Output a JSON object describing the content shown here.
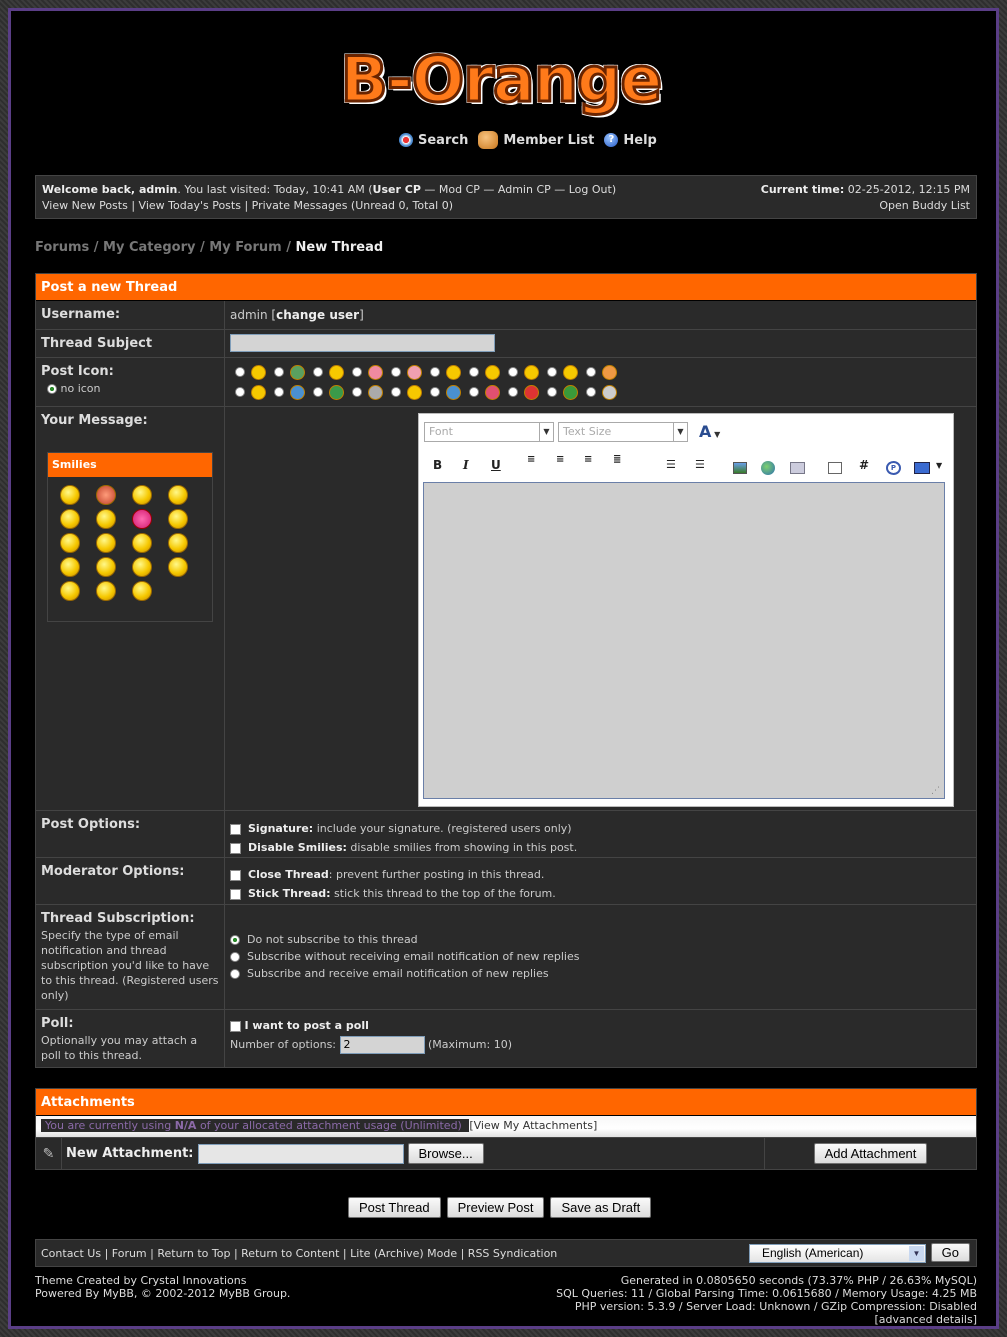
{
  "logo": {
    "text": "B-Orange"
  },
  "nav": {
    "search": "Search",
    "members": "Member List",
    "help": "Help"
  },
  "welcome": {
    "prefix": "Welcome back, ",
    "user": "admin",
    "visited": ". You last visited: Today, 10:41 AM (",
    "usercp": "User CP",
    "rest": " — Mod CP — Admin CP — Log Out)",
    "line2": "View New Posts | View Today's Posts | Private Messages (Unread 0, Total 0)",
    "time_label": "Current time:",
    "time_value": " 02-25-2012, 12:15 PM",
    "buddy": "Open Buddy List"
  },
  "breadcrumb": {
    "forums": "Forums",
    "sep": " / ",
    "category": "My Category",
    "forum": "My Forum",
    "current": "New Thread"
  },
  "form": {
    "title": "Post a new Thread",
    "username_label": "Username:",
    "username_value": "admin [",
    "change_user": "change user",
    "username_close": "]",
    "subject_label": "Thread Subject",
    "icon_label": "Post Icon:",
    "no_icon": "no icon",
    "message_label": "Your Message:",
    "smilies_title": "Smilies",
    "font_placeholder": "Font",
    "size_placeholder": "Text Size",
    "options_label": "Post Options:",
    "opt_sig_b": "Signature:",
    "opt_sig": " include your signature. (registered users only)",
    "opt_smil_b": "Disable Smilies:",
    "opt_smil": " disable smilies from showing in this post.",
    "mod_label": "Moderator Options:",
    "mod_close_b": "Close Thread",
    "mod_close": ": prevent further posting in this thread.",
    "mod_stick_b": "Stick Thread:",
    "mod_stick": " stick this thread to the top of the forum.",
    "sub_label": "Thread Subscription:",
    "sub_desc": "Specify the type of email notification and thread subscription you'd like to have to this thread. (Registered users only)",
    "sub_opt1": "Do not subscribe to this thread",
    "sub_opt2": "Subscribe without receiving email notification of new replies",
    "sub_opt3": "Subscribe and receive email notification of new replies",
    "poll_label": "Poll:",
    "poll_desc": "Optionally you may attach a poll to this thread.",
    "poll_check": "I want to post a poll",
    "poll_num": "Number of options:",
    "poll_value": "2",
    "poll_max": "(Maximum: 10)"
  },
  "attach": {
    "title": "Attachments",
    "usage_a": "You are currently using ",
    "usage_na": "N/A",
    "usage_b": " of your allocated attachment usage (Unlimited) ",
    "view": "[View My Attachments]",
    "new_label": "New Attachment:",
    "browse": "Browse...",
    "add": "Add Attachment"
  },
  "buttons": {
    "post": "Post Thread",
    "preview": "Preview Post",
    "draft": "Save as Draft"
  },
  "footer": {
    "links": "Contact Us | Forum | Return to Top | Return to Content | Lite (Archive) Mode | RSS Syndication",
    "lang": "English (American)",
    "go": "Go",
    "theme": "Theme Created by Crystal Innovations",
    "powered": "Powered By MyBB, © 2002-2012 MyBB Group.",
    "gen": "Generated in 0.0805650 seconds (73.37% PHP / 26.63% MySQL)",
    "sql": "SQL Queries: 11 / Global Parsing Time: 0.0615680 / Memory Usage: 4.25 MB",
    "php": "PHP version: 5.3.9 / Server Load: Unknown / GZip Compression: Disabled",
    "adv": "[advanced details]"
  }
}
